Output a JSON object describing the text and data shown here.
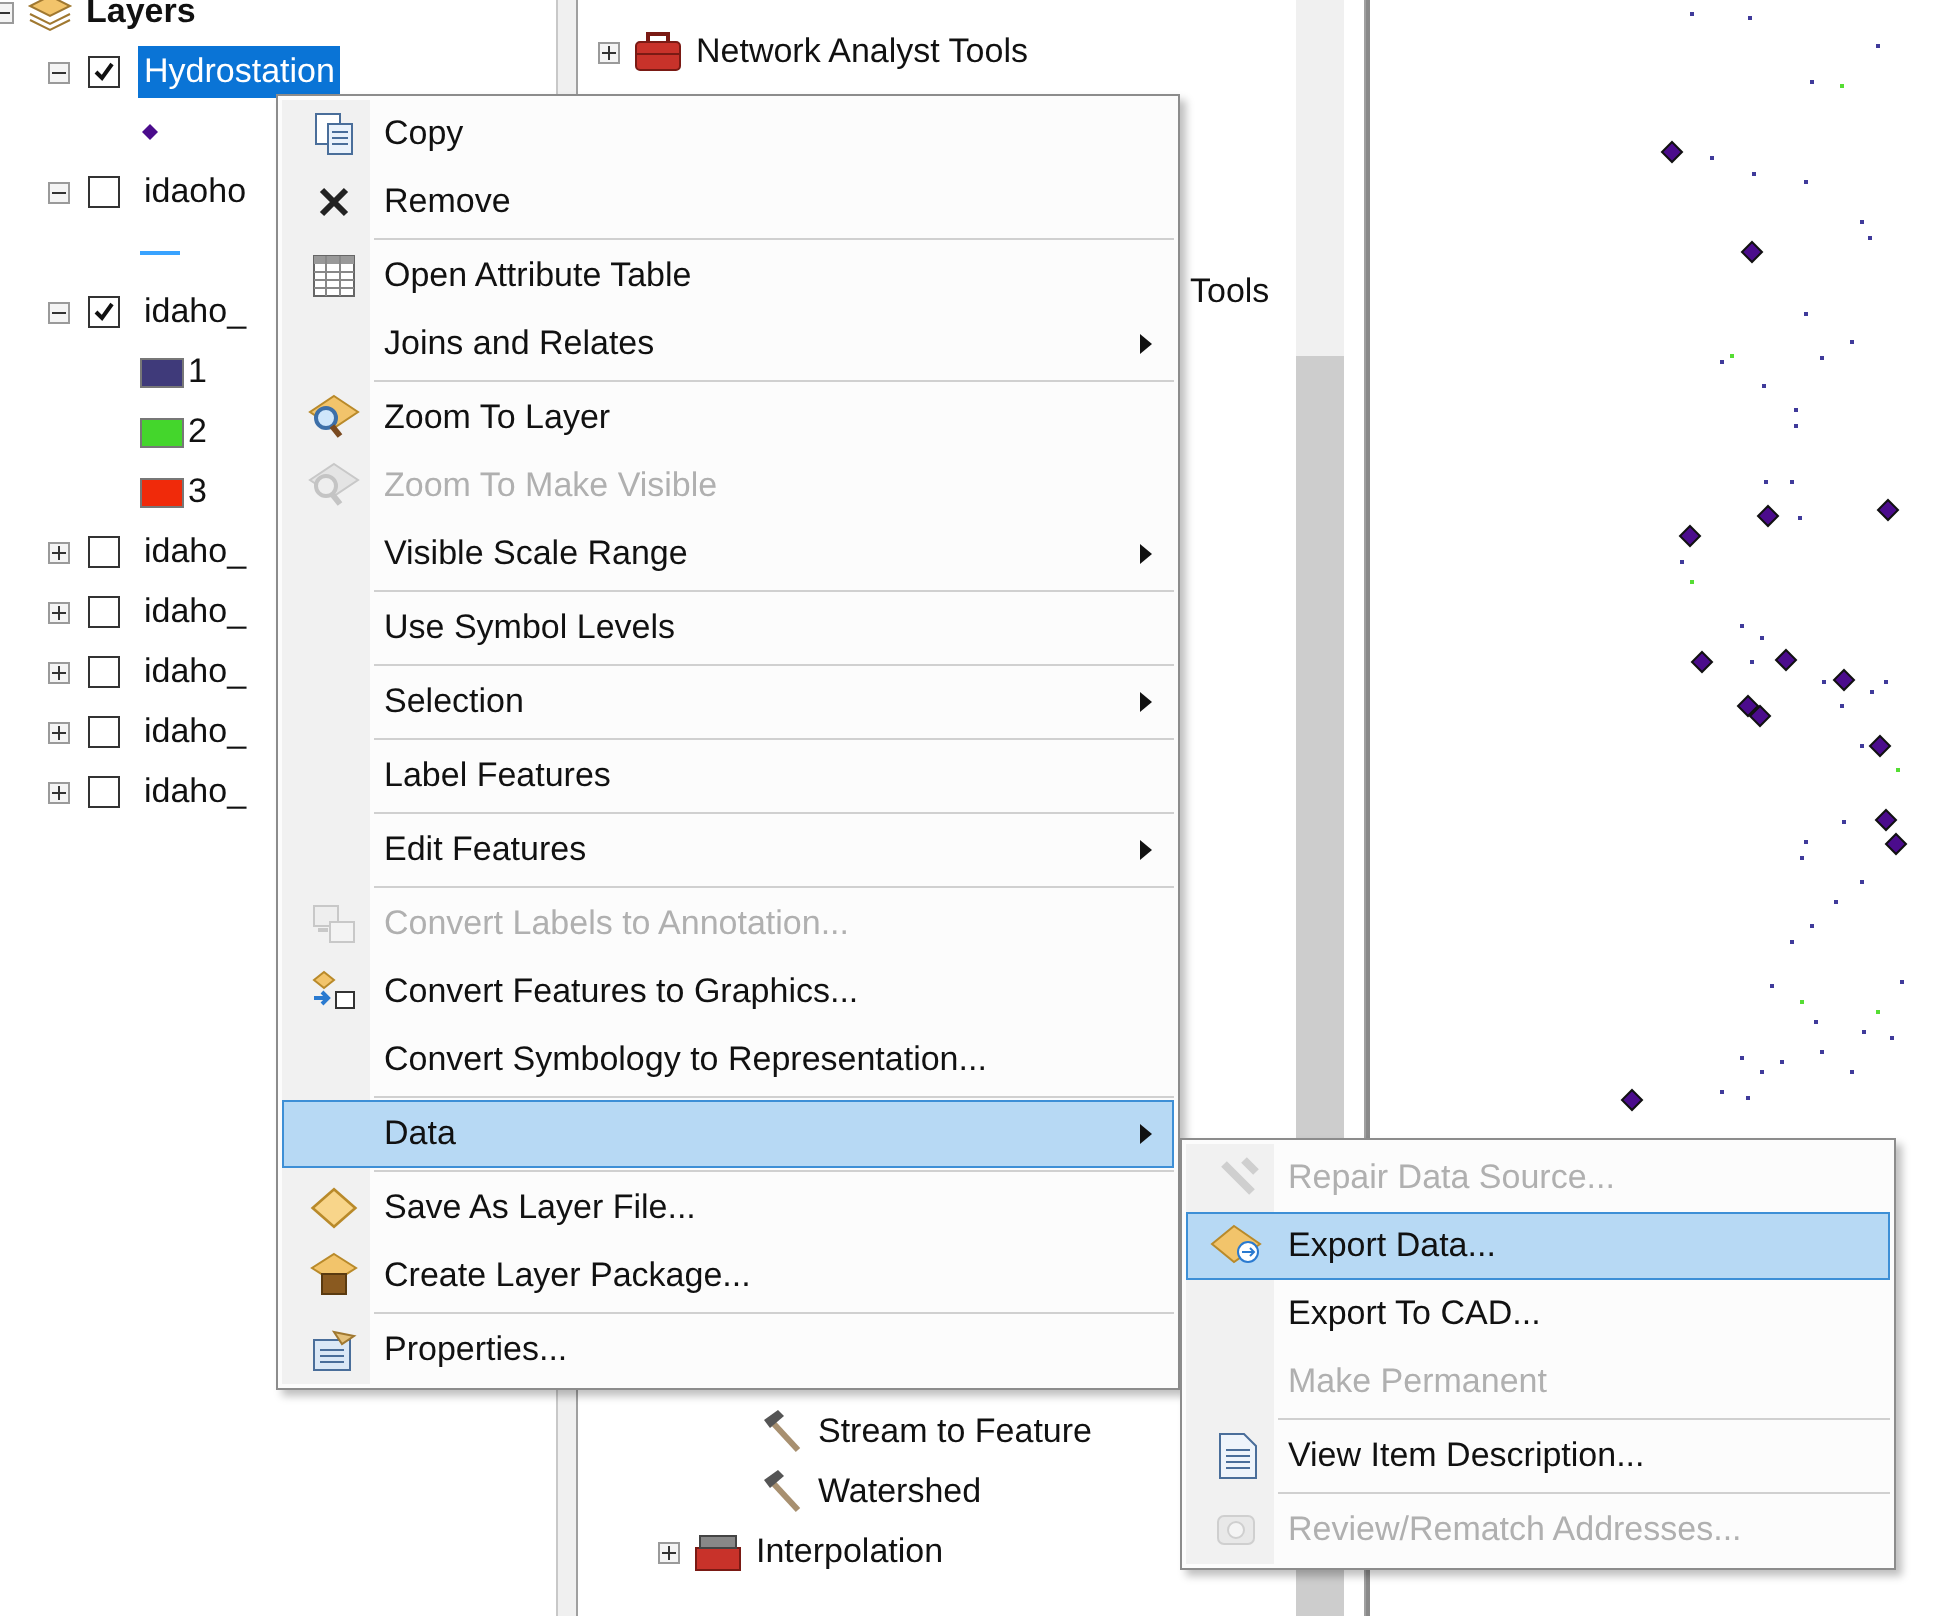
{
  "layers_panel": {
    "root": {
      "label": "Layers",
      "expanded": true
    },
    "layers": [
      {
        "name": "Hydrostation",
        "checked": true,
        "selected": true,
        "expanded": true,
        "legend": [
          {
            "kind": "point"
          }
        ]
      },
      {
        "name": "idaoho",
        "checked": false,
        "selected": false,
        "expanded": true,
        "legend": [
          {
            "kind": "line"
          }
        ]
      },
      {
        "name": "idaho_",
        "checked": true,
        "selected": false,
        "expanded": true,
        "legend": [
          {
            "kind": "fill",
            "color": "#3f3a7a",
            "label": "1"
          },
          {
            "kind": "fill",
            "color": "#44d62c",
            "label": "2"
          },
          {
            "kind": "fill",
            "color": "#f02a0a",
            "label": "3"
          }
        ]
      },
      {
        "name": "idaho_",
        "checked": false,
        "selected": false,
        "expanded": false
      },
      {
        "name": "idaho_",
        "checked": false,
        "selected": false,
        "expanded": false
      },
      {
        "name": "idaho_",
        "checked": false,
        "selected": false,
        "expanded": false
      },
      {
        "name": "idaho_",
        "checked": false,
        "selected": false,
        "expanded": false
      },
      {
        "name": "idaho_",
        "checked": false,
        "selected": false,
        "expanded": false
      }
    ]
  },
  "toolbox_panel": {
    "items": [
      {
        "label": "Network Analyst Tools",
        "kind": "toolbox",
        "expandable": true
      },
      {
        "label": "Tools",
        "kind": "text",
        "expandable": false
      },
      {
        "label": "Stream to Feature",
        "kind": "tool",
        "expandable": false
      },
      {
        "label": "Watershed",
        "kind": "tool",
        "expandable": false
      },
      {
        "label": "Interpolation",
        "kind": "toolset",
        "expandable": true
      }
    ]
  },
  "context_menu": {
    "groups": [
      [
        {
          "label": "Copy",
          "disabled": false,
          "submenu": false,
          "selected": false
        },
        {
          "label": "Remove",
          "disabled": false,
          "submenu": false,
          "selected": false
        }
      ],
      [
        {
          "label": "Open Attribute Table",
          "disabled": false,
          "submenu": false,
          "selected": false
        },
        {
          "label": "Joins and Relates",
          "disabled": false,
          "submenu": true,
          "selected": false
        }
      ],
      [
        {
          "label": "Zoom To Layer",
          "disabled": false,
          "submenu": false,
          "selected": false
        },
        {
          "label": "Zoom To Make Visible",
          "disabled": true,
          "submenu": false,
          "selected": false
        },
        {
          "label": "Visible Scale Range",
          "disabled": false,
          "submenu": true,
          "selected": false
        }
      ],
      [
        {
          "label": "Use Symbol Levels",
          "disabled": false,
          "submenu": false,
          "selected": false
        }
      ],
      [
        {
          "label": "Selection",
          "disabled": false,
          "submenu": true,
          "selected": false
        }
      ],
      [
        {
          "label": "Label Features",
          "disabled": false,
          "submenu": false,
          "selected": false
        }
      ],
      [
        {
          "label": "Edit Features",
          "disabled": false,
          "submenu": true,
          "selected": false
        }
      ],
      [
        {
          "label": "Convert Labels to Annotation...",
          "disabled": true,
          "submenu": false,
          "selected": false
        },
        {
          "label": "Convert Features to Graphics...",
          "disabled": false,
          "submenu": false,
          "selected": false
        },
        {
          "label": "Convert Symbology to Representation...",
          "disabled": false,
          "submenu": false,
          "selected": false
        }
      ],
      [
        {
          "label": "Data",
          "disabled": false,
          "submenu": true,
          "selected": true
        }
      ],
      [
        {
          "label": "Save As Layer File...",
          "disabled": false,
          "submenu": false,
          "selected": false
        },
        {
          "label": "Create Layer Package...",
          "disabled": false,
          "submenu": false,
          "selected": false
        }
      ],
      [
        {
          "label": "Properties...",
          "disabled": false,
          "submenu": false,
          "selected": false
        }
      ]
    ]
  },
  "data_submenu": {
    "groups": [
      [
        {
          "label": "Repair Data Source...",
          "disabled": true,
          "selected": false
        },
        {
          "label": "Export Data...",
          "disabled": false,
          "selected": true
        },
        {
          "label": "Export To CAD...",
          "disabled": false,
          "selected": false
        },
        {
          "label": "Make Permanent",
          "disabled": true,
          "selected": false
        }
      ],
      [
        {
          "label": "View Item Description...",
          "disabled": false,
          "selected": false
        }
      ],
      [
        {
          "label": "Review/Rematch Addresses...",
          "disabled": true,
          "selected": false
        }
      ]
    ]
  }
}
